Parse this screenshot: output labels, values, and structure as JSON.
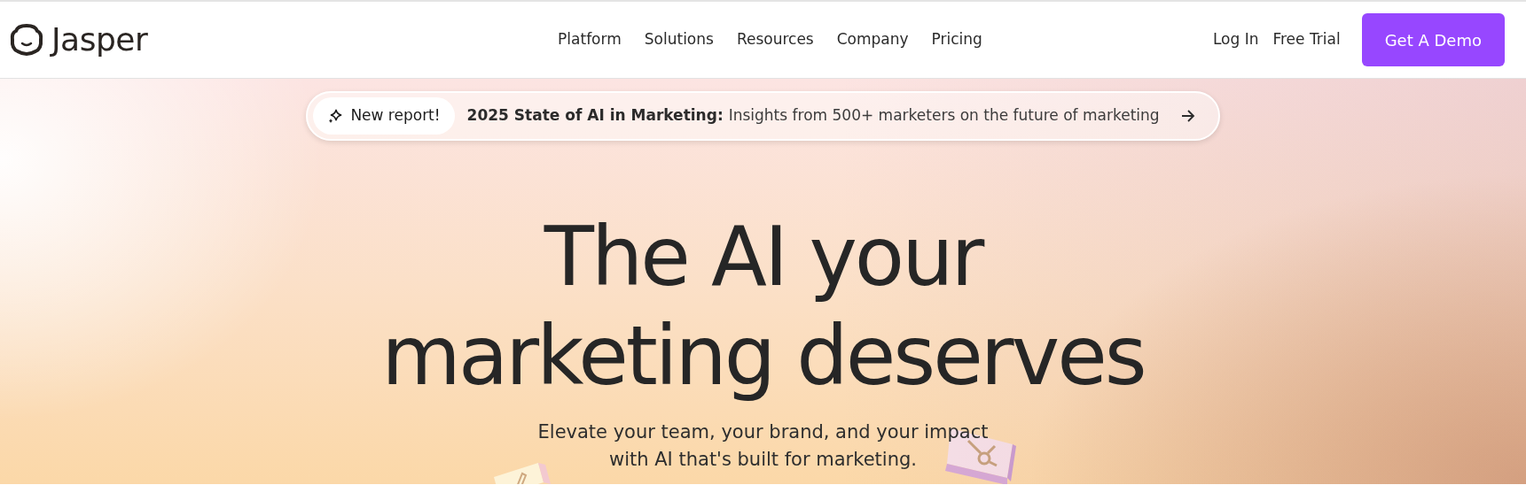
{
  "brand": {
    "name": "Jasper"
  },
  "nav": {
    "items": [
      {
        "label": "Platform"
      },
      {
        "label": "Solutions"
      },
      {
        "label": "Resources"
      },
      {
        "label": "Company"
      },
      {
        "label": "Pricing"
      }
    ],
    "links": [
      {
        "label": "Log In"
      },
      {
        "label": "Free Trial"
      }
    ],
    "cta": {
      "label": "Get A Demo"
    }
  },
  "banner": {
    "tag": "New report!",
    "title": "2025 State of AI in Marketing:",
    "text": "Insights from 500+ marketers on the future of marketing"
  },
  "hero": {
    "headline": [
      "The AI your",
      "marketing deserves"
    ],
    "subtitle": [
      "Elevate your team, your brand, and your impact",
      "with AI that's built for marketing."
    ]
  }
}
